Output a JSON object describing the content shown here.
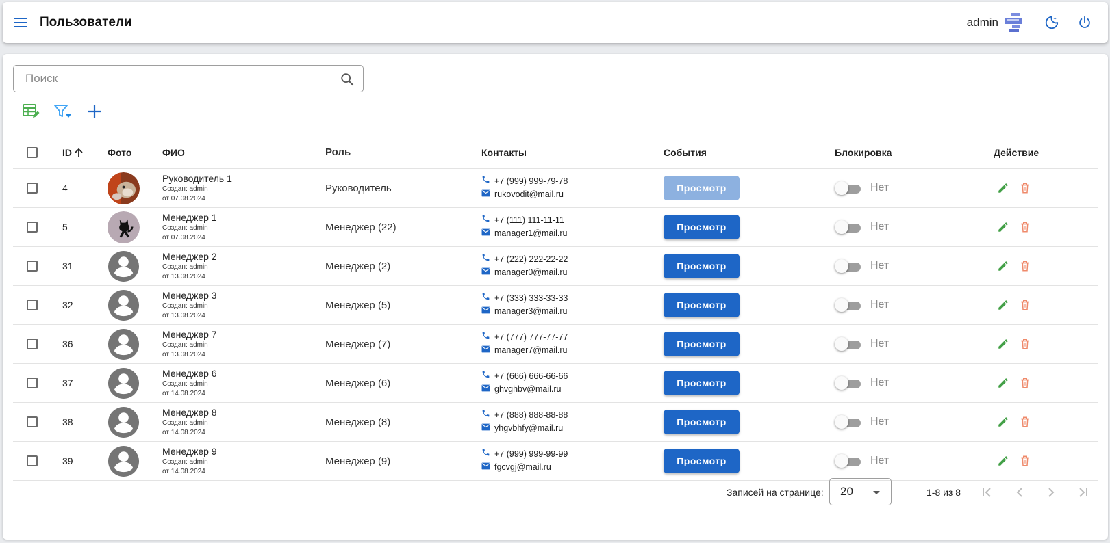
{
  "appbar": {
    "title": "Пользователи",
    "user_name": "admin"
  },
  "search": {
    "placeholder": "Поиск"
  },
  "colors": {
    "primary": "#1e66c6",
    "primary_disabled": "#8db1e0",
    "edit": "#43a047",
    "delete": "#ef8a6b",
    "tool_table": "#4caf50",
    "tool_filter": "#42a5f5"
  },
  "toolbar_icons": [
    "table-edit-icon",
    "filter-icon",
    "add-icon"
  ],
  "table": {
    "headers": {
      "id": "ID",
      "photo": "Фото",
      "name": "ФИО",
      "role": "Роль",
      "contacts": "Контакты",
      "events": "События",
      "block": "Блокировка",
      "action": "Действие"
    },
    "rows": [
      {
        "id": "4",
        "name": "Руководитель 1",
        "created_by": "Создан: admin",
        "created_at": "от 07.08.2024",
        "role": "Руководитель",
        "phone": "+7 (999) 999-79-78",
        "email": "rukovodit@mail.ru",
        "events_btn": "Просмотр",
        "events_disabled": true,
        "block_label": "Нет",
        "avatar": "photo-hamster"
      },
      {
        "id": "5",
        "name": "Менеджер 1",
        "created_by": "Создан: admin",
        "created_at": "от 07.08.2024",
        "role": "Менеджер (22)",
        "phone": "+7 (111) 111-11-11",
        "email": "manager1@mail.ru",
        "events_btn": "Просмотр",
        "events_disabled": false,
        "block_label": "Нет",
        "avatar": "photo-cat"
      },
      {
        "id": "31",
        "name": "Менеджер 2",
        "created_by": "Создан: admin",
        "created_at": "от 13.08.2024",
        "role": "Менеджер (2)",
        "phone": "+7 (222) 222-22-22",
        "email": "manager0@mail.ru",
        "events_btn": "Просмотр",
        "events_disabled": false,
        "block_label": "Нет",
        "avatar": "default"
      },
      {
        "id": "32",
        "name": "Менеджер 3",
        "created_by": "Создан: admin",
        "created_at": "от 13.08.2024",
        "role": "Менеджер (5)",
        "phone": "+7 (333) 333-33-33",
        "email": "manager3@mail.ru",
        "events_btn": "Просмотр",
        "events_disabled": false,
        "block_label": "Нет",
        "avatar": "default"
      },
      {
        "id": "36",
        "name": "Менеджер 7",
        "created_by": "Создан: admin",
        "created_at": "от 13.08.2024",
        "role": "Менеджер (7)",
        "phone": "+7 (777) 777-77-77",
        "email": "manager7@mail.ru",
        "events_btn": "Просмотр",
        "events_disabled": false,
        "block_label": "Нет",
        "avatar": "default"
      },
      {
        "id": "37",
        "name": "Менеджер 6",
        "created_by": "Создан: admin",
        "created_at": "от 14.08.2024",
        "role": "Менеджер (6)",
        "phone": "+7 (666) 666-66-66",
        "email": "ghvghbv@mail.ru",
        "events_btn": "Просмотр",
        "events_disabled": false,
        "block_label": "Нет",
        "avatar": "default"
      },
      {
        "id": "38",
        "name": "Менеджер 8",
        "created_by": "Создан: admin",
        "created_at": "от 14.08.2024",
        "role": "Менеджер (8)",
        "phone": "+7 (888) 888-88-88",
        "email": "yhgvbhfy@mail.ru",
        "events_btn": "Просмотр",
        "events_disabled": false,
        "block_label": "Нет",
        "avatar": "default"
      },
      {
        "id": "39",
        "name": "Менеджер 9",
        "created_by": "Создан: admin",
        "created_at": "от 14.08.2024",
        "role": "Менеджер (9)",
        "phone": "+7 (999) 999-99-99",
        "email": "fgcvgj@mail.ru",
        "events_btn": "Просмотр",
        "events_disabled": false,
        "block_label": "Нет",
        "avatar": "default"
      }
    ]
  },
  "pagination": {
    "per_page_label": "Записей на странице:",
    "per_page_value": "20",
    "range_text": "1-8 из 8"
  }
}
